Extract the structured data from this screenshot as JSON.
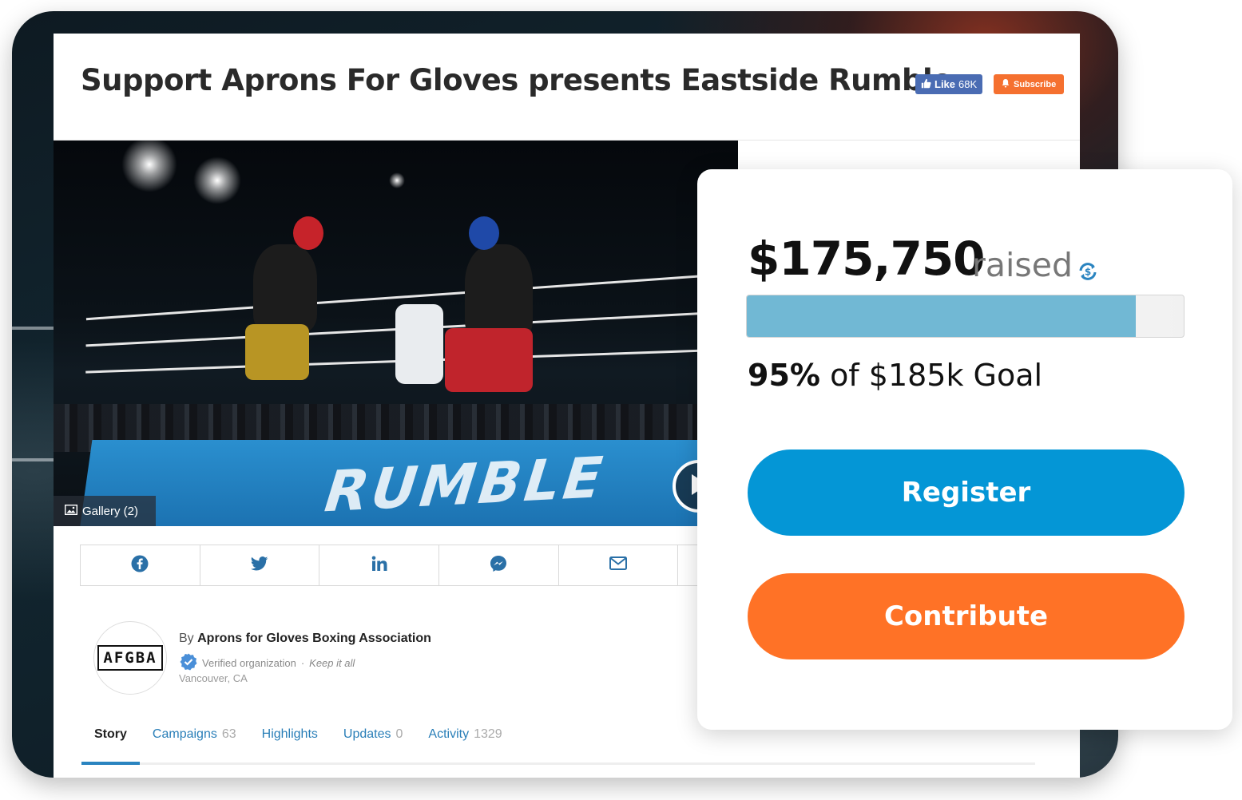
{
  "header": {
    "title": "Support Aprons For Gloves presents Eastside Rumble",
    "like_label": "Like",
    "like_count": "68K",
    "subscribe_label": "Subscribe"
  },
  "hero": {
    "gallery_label": "Gallery (2)",
    "mat_text": "RUMBLE"
  },
  "share": {
    "items": [
      "facebook-icon",
      "twitter-icon",
      "linkedin-icon",
      "messenger-icon",
      "email-icon"
    ]
  },
  "organization": {
    "logo_text": "AFGBA",
    "by_prefix": "By",
    "name": "Aprons for Gloves Boxing Association",
    "verified": "Verified organization",
    "separator": "·",
    "tagline": "Keep it all",
    "location": "Vancouver, CA"
  },
  "tabs": [
    {
      "label": "Story",
      "count": "",
      "active": true
    },
    {
      "label": "Campaigns",
      "count": "63",
      "active": false
    },
    {
      "label": "Highlights",
      "count": "",
      "active": false
    },
    {
      "label": "Updates",
      "count": "0",
      "active": false
    },
    {
      "label": "Activity",
      "count": "1329",
      "active": false
    }
  ],
  "funding": {
    "amount": "$175,750",
    "raised_label": "raised",
    "percent": "95%",
    "goal_text": "of $185k Goal",
    "progress_fraction": 0.89,
    "register_label": "Register",
    "contribute_label": "Contribute"
  },
  "colors": {
    "register": "#0496d6",
    "contribute": "#ff7226",
    "progress": "#71b8d4",
    "tab_link": "#2a7fb8",
    "facebook": "#4a6cb3",
    "subscribe": "#f5702f"
  }
}
